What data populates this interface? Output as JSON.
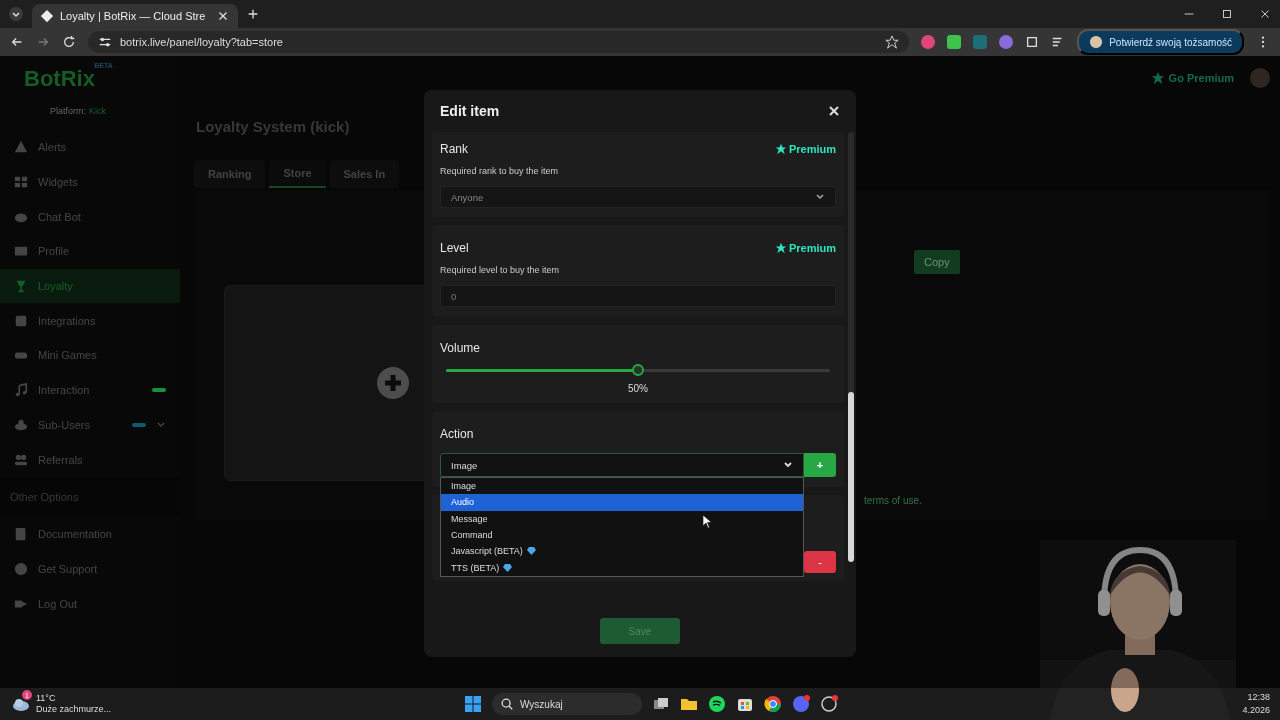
{
  "browser": {
    "tab_title": "Loyalty | BotRix — Cloud Stre",
    "url": "botrix.live/panel/loyalty?tab=store",
    "profile_button": "Potwierdź swoją tożsamość"
  },
  "sidebar": {
    "logo": "BotRix",
    "logo_badge": "BETA",
    "platform_label": "Platform:",
    "platform_value": "Kick",
    "items": [
      {
        "label": "Alerts",
        "selected": false
      },
      {
        "label": "Widgets",
        "selected": false
      },
      {
        "label": "Chat Bot",
        "selected": false
      },
      {
        "label": "Profile",
        "selected": false
      },
      {
        "label": "Loyalty",
        "selected": true
      },
      {
        "label": "Integrations",
        "selected": false
      },
      {
        "label": "Mini Games",
        "selected": false
      },
      {
        "label": "Interaction",
        "selected": false,
        "color": "#18913f"
      },
      {
        "label": "Sub-Users",
        "selected": false,
        "color": "#0b5a70",
        "expandable": true
      },
      {
        "label": "Referrals",
        "selected": false
      }
    ],
    "section_title": "Other Options",
    "other_items": [
      {
        "label": "Documentation"
      },
      {
        "label": "Get Support"
      },
      {
        "label": "Log Out"
      }
    ]
  },
  "main": {
    "go_premium": "Go Premium",
    "title": "Loyalty System (kick)",
    "tabs": [
      {
        "label": "Ranking",
        "selected": false
      },
      {
        "label": "Store",
        "selected": true
      },
      {
        "label": "Sales In",
        "selected": false
      }
    ],
    "copy_button": "Copy",
    "terms_text": "terms of use."
  },
  "modal": {
    "title": "Edit item",
    "sections": [
      {
        "kind": "select",
        "title": "Rank",
        "premium": "Premium",
        "description": "Required rank to buy the item",
        "value": "Anyone"
      },
      {
        "kind": "number",
        "title": "Level",
        "premium": "Premium",
        "description": "Required level to buy the item",
        "placeholder": "0"
      },
      {
        "kind": "slider",
        "title": "Volume",
        "level": 0.5,
        "reading": "50%"
      },
      {
        "kind": "action",
        "title": "Action",
        "value": "Image",
        "add_button": "+"
      },
      {
        "kind": "remove",
        "remove_button": "-"
      }
    ],
    "dropdown": {
      "options": [
        {
          "label": "Image",
          "selected": false,
          "premium": false
        },
        {
          "label": "Audio",
          "selected": true,
          "premium": false
        },
        {
          "label": "Message",
          "selected": false,
          "premium": false
        },
        {
          "label": "Command",
          "selected": false,
          "premium": false
        },
        {
          "label": "Javascript (BETA)",
          "selected": false,
          "premium": true
        },
        {
          "label": "TTS (BETA)",
          "selected": false,
          "premium": true
        }
      ]
    },
    "save_button": "Save"
  },
  "taskbar": {
    "notification_count": "1",
    "temperature": "11°C",
    "weather": "Duże zachmurze...",
    "search_placeholder": "Wyszukaj",
    "time": "12:38",
    "date": "4.2026"
  }
}
